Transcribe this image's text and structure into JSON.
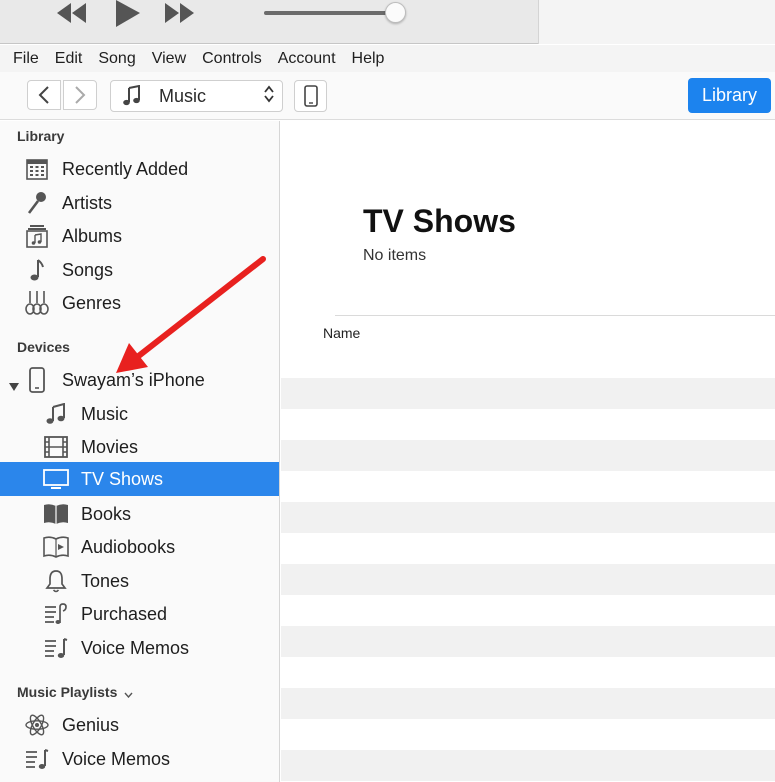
{
  "menu": [
    "File",
    "Edit",
    "Song",
    "View",
    "Controls",
    "Account",
    "Help"
  ],
  "player": {
    "volume": 1.0
  },
  "toolbar": {
    "media_kind": "Music",
    "library_button": "Library"
  },
  "sidebar": {
    "library_header": "Library",
    "library_items": [
      {
        "label": "Recently Added",
        "icon": "calendar-grid-icon"
      },
      {
        "label": "Artists",
        "icon": "microphone-icon"
      },
      {
        "label": "Albums",
        "icon": "album-icon"
      },
      {
        "label": "Songs",
        "icon": "music-note-icon"
      },
      {
        "label": "Genres",
        "icon": "guitars-icon"
      }
    ],
    "devices_header": "Devices",
    "device_name": "Swayam’s iPhone",
    "device_items": [
      {
        "label": "Music",
        "icon": "music-note-icon"
      },
      {
        "label": "Movies",
        "icon": "film-strip-icon"
      },
      {
        "label": "TV Shows",
        "icon": "tv-icon",
        "selected": true
      },
      {
        "label": "Books",
        "icon": "book-icon"
      },
      {
        "label": "Audiobooks",
        "icon": "audiobook-icon"
      },
      {
        "label": "Tones",
        "icon": "bell-icon"
      },
      {
        "label": "Purchased",
        "icon": "purchased-list-icon"
      },
      {
        "label": "Voice Memos",
        "icon": "voice-memo-list-icon"
      }
    ],
    "playlists_header": "Music Playlists",
    "playlist_items": [
      {
        "label": "Genius",
        "icon": "atom-icon"
      },
      {
        "label": "Voice Memos",
        "icon": "voice-memo-list-icon"
      }
    ]
  },
  "content": {
    "title": "TV Shows",
    "subtitle": "No items",
    "column_name": "Name"
  },
  "colors": {
    "accent": "#1c83ee",
    "selection": "#2b86eb",
    "annotation_arrow": "#e8211f"
  }
}
